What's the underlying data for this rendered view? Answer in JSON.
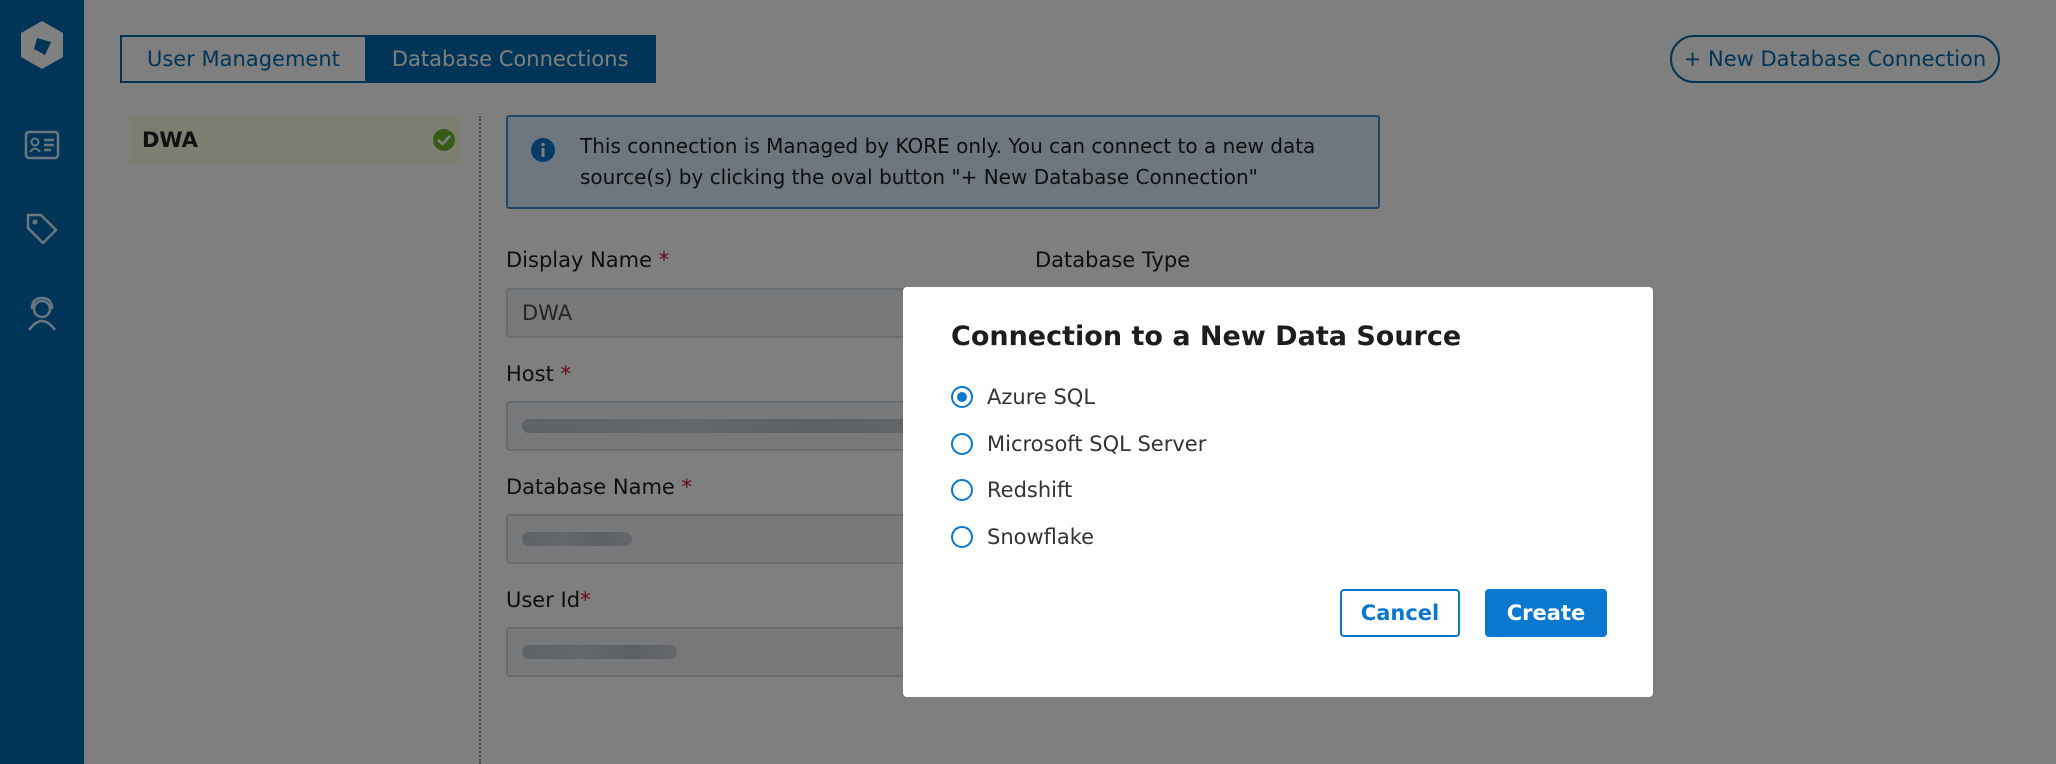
{
  "sidebar": {
    "items": [
      {
        "icon": "logo-icon"
      },
      {
        "icon": "id-card-icon"
      },
      {
        "icon": "tag-icon"
      },
      {
        "icon": "user-support-icon"
      }
    ]
  },
  "tabs": [
    {
      "label": "User Management",
      "active": false
    },
    {
      "label": "Database Connections",
      "active": true
    }
  ],
  "new_connection_button": "+ New Database Connection",
  "connections": [
    {
      "name": "DWA",
      "status": "connected"
    }
  ],
  "info_banner": "This connection is Managed by KORE only. You can connect to a new data source(s) by clicking the oval button \"+ New Database Connection\"",
  "form": {
    "display_name": {
      "label": "Display Name",
      "required_mark": "*",
      "value": "DWA"
    },
    "database_type": {
      "label": "Database Type"
    },
    "host": {
      "label": "Host",
      "required_mark": "*"
    },
    "database_name": {
      "label": "Database Name",
      "required_mark": "*"
    },
    "user_id": {
      "label": "User Id",
      "required_mark": "*"
    }
  },
  "modal": {
    "title": "Connection to a New Data Source",
    "options": [
      {
        "label": "Azure SQL",
        "selected": true
      },
      {
        "label": "Microsoft SQL Server",
        "selected": false
      },
      {
        "label": "Redshift",
        "selected": false
      },
      {
        "label": "Snowflake",
        "selected": false
      }
    ],
    "cancel_label": "Cancel",
    "create_label": "Create"
  },
  "colors": {
    "sidebar": "#036bb0",
    "primary": "#0a78cf",
    "info_bg": "#dcefff",
    "selected_row_bg": "#fdfbe4",
    "success": "#6fb92c",
    "required": "#c8102e"
  }
}
